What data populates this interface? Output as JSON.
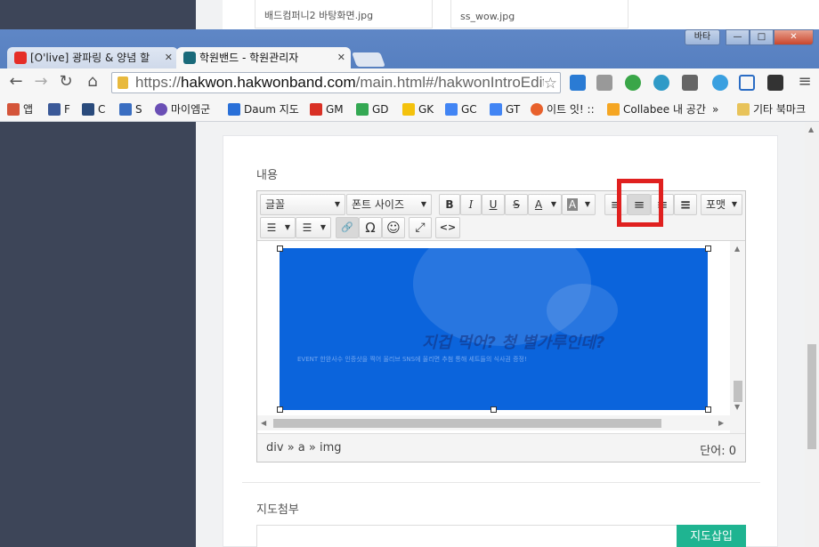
{
  "background_page": {
    "thumbs": [
      "배드컴퍼니2 바탕화면.jpg",
      "ss_wow.jpg"
    ]
  },
  "browser": {
    "tabs": [
      {
        "title": "[O'live] 광파링 & 양념 할",
        "active": false,
        "favicon_color": "#e52d27"
      },
      {
        "title": "학원밴드 - 학원관리자",
        "active": true,
        "favicon_color": "#1a6a7a"
      }
    ],
    "window_buttons": {
      "language": "바타",
      "minimize": "—",
      "maximize": "□",
      "close": "✕"
    },
    "url": {
      "scheme": "https://",
      "host": "hakwon.hakwonband.com",
      "path": "/main.html#/hakwonIntroEdit"
    },
    "bookmarks": [
      {
        "label": "앱",
        "color": "#d4553a"
      },
      {
        "label": "F",
        "color": "#3b5998"
      },
      {
        "label": "C",
        "color": "#2a4b7c"
      },
      {
        "label": "S",
        "color": "#3a6ec1"
      },
      {
        "label": "마이엠군",
        "color": "#6a4fb5"
      },
      {
        "label": "Daum 지도",
        "color": "#2a70d8"
      },
      {
        "label": "GM",
        "color": "#d93025"
      },
      {
        "label": "GD",
        "color": "#34a853"
      },
      {
        "label": "GK",
        "color": "#f4c20d"
      },
      {
        "label": "GC",
        "color": "#4285f4"
      },
      {
        "label": "GT",
        "color": "#4285f4"
      },
      {
        "label": "이트 잇! ::",
        "color": "#e8612c"
      },
      {
        "label": "Collabee 내 공간",
        "color": "#f5a623"
      },
      {
        "label": "»",
        "color": ""
      },
      {
        "label": "기타 북마크",
        "color": "#e8c35a"
      }
    ]
  },
  "form": {
    "content_label": "내용",
    "map_label": "지도첨부",
    "map_button": "지도삽입"
  },
  "editor": {
    "font_select": "글꼴",
    "size_select": "폰트 사이즈",
    "format_select": "포맷",
    "buttons": {
      "bold": "B",
      "italic": "I",
      "underline": "U",
      "strike": "S",
      "font_color": "A",
      "bg_color": "A",
      "align_left": "≡",
      "align_center": "≡",
      "align_right": "≡",
      "align_justify": "≡",
      "bullet_list": "☰",
      "numbered_list": "☰",
      "link": "🔗",
      "special_char": "Ω",
      "emoticon": "☺",
      "fullscreen": "⤢",
      "source": "<>"
    },
    "image_overlay_text": "지겁 먹어? 청 별가루인데?",
    "image_banner_text": "EVENT  한완사수 인증샷을 찍어 올리브 SNS에 올리면 추첨 통해 세트들의 식사권 증정!",
    "image_color": "#0b64dc",
    "status_path": "div » a » img",
    "word_count": "단어: 0"
  },
  "highlight_color": "#e0201f",
  "accent_color": "#1fb491"
}
